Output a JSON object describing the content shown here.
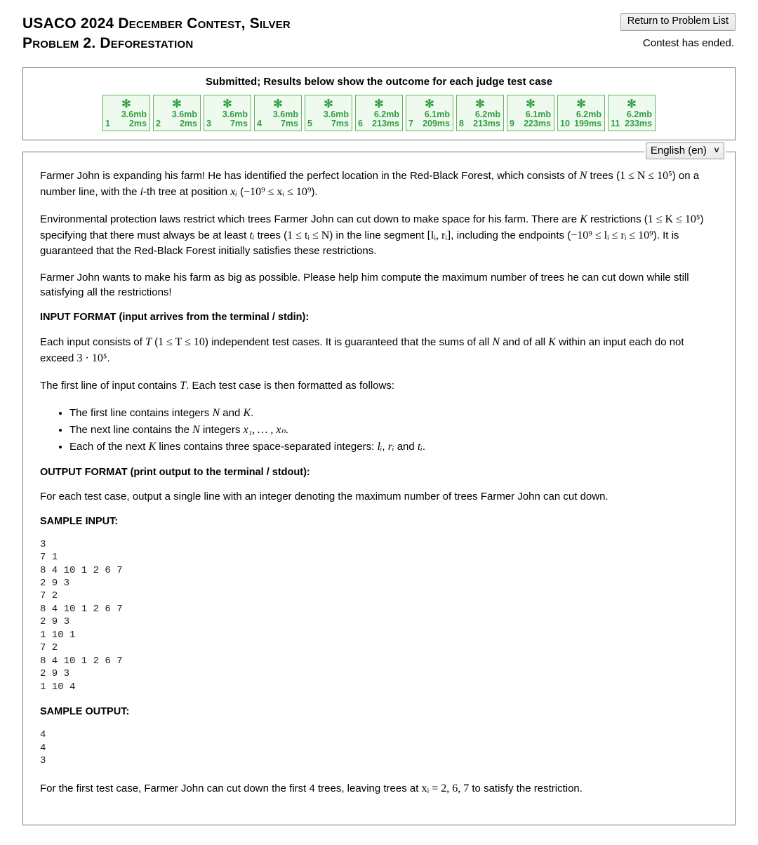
{
  "header": {
    "contest_title": "USACO 2024 December Contest, Silver",
    "problem_title": "Problem 2. Deforestation",
    "return_button": "Return to Problem List",
    "contest_status": "Contest has ended."
  },
  "results": {
    "title": "Submitted; Results below show the outcome for each judge test case",
    "status_glyph": "✻",
    "cases": [
      {
        "num": "1",
        "memory": "3.6mb",
        "time": "2ms",
        "status": "pass"
      },
      {
        "num": "2",
        "memory": "3.6mb",
        "time": "2ms",
        "status": "pass"
      },
      {
        "num": "3",
        "memory": "3.6mb",
        "time": "7ms",
        "status": "pass"
      },
      {
        "num": "4",
        "memory": "3.6mb",
        "time": "7ms",
        "status": "pass"
      },
      {
        "num": "5",
        "memory": "3.6mb",
        "time": "7ms",
        "status": "pass"
      },
      {
        "num": "6",
        "memory": "6.2mb",
        "time": "213ms",
        "status": "pass"
      },
      {
        "num": "7",
        "memory": "6.1mb",
        "time": "209ms",
        "status": "pass"
      },
      {
        "num": "8",
        "memory": "6.2mb",
        "time": "213ms",
        "status": "pass"
      },
      {
        "num": "9",
        "memory": "6.1mb",
        "time": "223ms",
        "status": "pass"
      },
      {
        "num": "10",
        "memory": "6.2mb",
        "time": "199ms",
        "status": "pass"
      },
      {
        "num": "11",
        "memory": "6.2mb",
        "time": "233ms",
        "status": "pass"
      }
    ],
    "pass_color": "#2f9e41",
    "pass_bg": "#eefaee",
    "pass_border": "#62b262"
  },
  "language": {
    "selected": "English (en)",
    "chevron": "∨"
  },
  "statement": {
    "intro_1a": "Farmer John is expanding his farm! He has identified the perfect location in the Red-Black Forest, which consists of ",
    "intro_1b": " trees (",
    "intro_1c": ") on a number line, with the ",
    "intro_1d": "-th tree at position ",
    "intro_1e": " (",
    "intro_1f": ").",
    "para2_a": "Environmental protection laws restrict which trees Farmer John can cut down to make space for his farm. There are ",
    "para2_b": " restrictions (",
    "para2_c": ") specifying that there must always be at least ",
    "para2_d": " trees (",
    "para2_e": ") in the line segment ",
    "para2_f": ", including the endpoints (",
    "para2_g": "). It is guaranteed that the Red-Black Forest initially satisfies these restrictions.",
    "para3": "Farmer John wants to make his farm as big as possible. Please help him compute the maximum number of trees he can cut down while still satisfying all the restrictions!",
    "input_format_heading": "INPUT FORMAT (input arrives from the terminal / stdin):",
    "input_para_a": "Each input consists of ",
    "input_para_b": " (",
    "input_para_c": ") independent test cases. It is guaranteed that the sums of all ",
    "input_para_d": " and of all ",
    "input_para_e": " within an input each do not exceed ",
    "input_para_f": ".",
    "first_line_a": "The first line of input contains ",
    "first_line_b": ". Each test case is then formatted as follows:",
    "bullet1_a": "The first line contains integers ",
    "bullet1_b": " and ",
    "bullet1_c": ".",
    "bullet2_a": "The next line contains the ",
    "bullet2_b": " integers ",
    "bullet2_c": ".",
    "bullet3_a": "Each of the next ",
    "bullet3_b": " lines contains three space-separated integers: ",
    "bullet3_c": ", ",
    "bullet3_d": " and ",
    "bullet3_e": ".",
    "output_format_heading": "OUTPUT FORMAT (print output to the terminal / stdout):",
    "output_para": "For each test case, output a single line with an integer denoting the maximum number of trees Farmer John can cut down.",
    "sample_input_heading": "SAMPLE INPUT:",
    "sample_input": "3\n7 1\n8 4 10 1 2 6 7\n2 9 3\n7 2\n8 4 10 1 2 6 7\n2 9 3\n1 10 1\n7 2\n8 4 10 1 2 6 7\n2 9 3\n1 10 4",
    "sample_output_heading": "SAMPLE OUTPUT:",
    "sample_output": "4\n4\n3",
    "explain_a": "For the first test case, Farmer John can cut down the first 4 trees, leaving trees at ",
    "explain_b": " to satisfy the restriction."
  },
  "math": {
    "N": "N",
    "K": "K",
    "T": "T",
    "i": "i",
    "N_range": "1 ≤ N ≤ 10⁵",
    "x_i": "xᵢ",
    "x_range": "−10⁹ ≤ xᵢ ≤ 10⁹",
    "K_range": "1 ≤ K ≤ 10⁵",
    "t_i": "tᵢ",
    "t_range": "1 ≤ tᵢ ≤ N",
    "segment": "[lᵢ, rᵢ]",
    "lr_range": "−10⁹ ≤ lᵢ ≤ rᵢ ≤ 10⁹",
    "T_range": "1 ≤ T ≤ 10",
    "sum_limit": "3 · 10⁵",
    "x_list": "x₁, … , xₙ",
    "l_i": "lᵢ",
    "r_i": "rᵢ",
    "explain_values": "xᵢ = 2, 6, 7"
  }
}
